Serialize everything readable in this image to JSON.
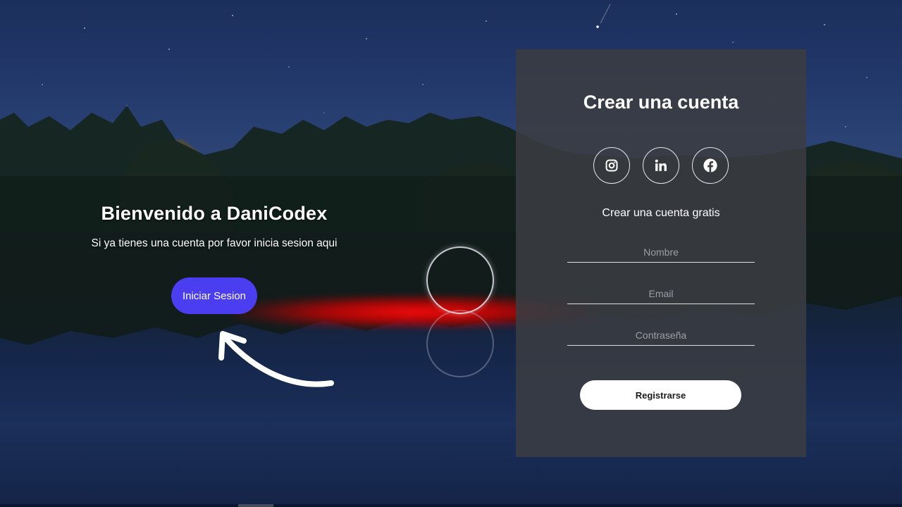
{
  "welcome": {
    "title": "Bienvenido a DaniCodex",
    "text": "Si ya tienes una cuenta por favor inicia sesion aqui",
    "login_label": "Iniciar Sesion"
  },
  "register": {
    "title": "Crear una cuenta",
    "socials": [
      "instagram-icon",
      "linkedin-icon",
      "facebook-icon"
    ],
    "subtitle": "Crear una cuenta gratis",
    "name_placeholder": "Nombre",
    "email_placeholder": "Email",
    "password_placeholder": "Contraseña",
    "submit_label": "Registrarse"
  },
  "colors": {
    "primary_button": "#4b3df0",
    "panel": "#3a3c42"
  }
}
